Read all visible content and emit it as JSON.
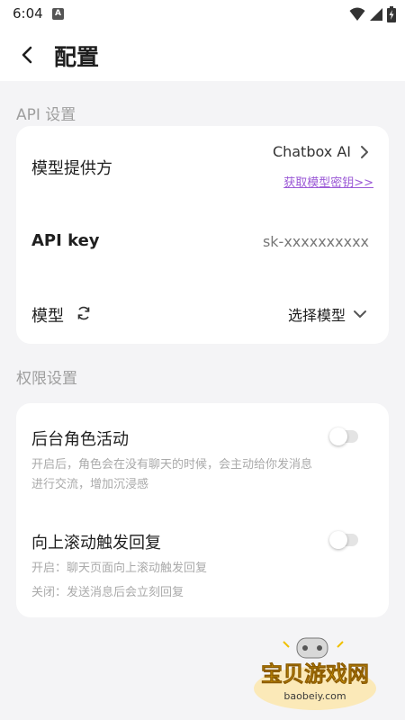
{
  "status": {
    "time": "6:04",
    "notif_icon": "A"
  },
  "header": {
    "title": "配置"
  },
  "api_section": {
    "title": "API 设置",
    "provider": {
      "label": "模型提供方",
      "value": "Chatbox AI",
      "link": "获取模型密钥>>"
    },
    "api_key": {
      "label": "API key",
      "value": "sk-xxxxxxxxxx"
    },
    "model": {
      "label": "模型",
      "value": "选择模型"
    }
  },
  "perm_section": {
    "title": "权限设置",
    "bg_activity": {
      "label": "后台角色活动",
      "desc1": "开启后，角色会在没有聊天的时候，会主动给你发消息",
      "desc2": "进行交流，增加沉浸感",
      "enabled": false
    },
    "scroll_reply": {
      "label": "向上滚动触发回复",
      "desc1": "开启：聊天页面向上滚动触发回复",
      "desc2": "关闭：发送消息后会立刻回复",
      "enabled": false
    }
  },
  "watermark": {
    "text": "宝贝游戏网",
    "url": "baobeiy.com"
  },
  "colors": {
    "accent_link": "#9b59d6",
    "card": "#ffffff",
    "background": "#f4f4f6"
  }
}
